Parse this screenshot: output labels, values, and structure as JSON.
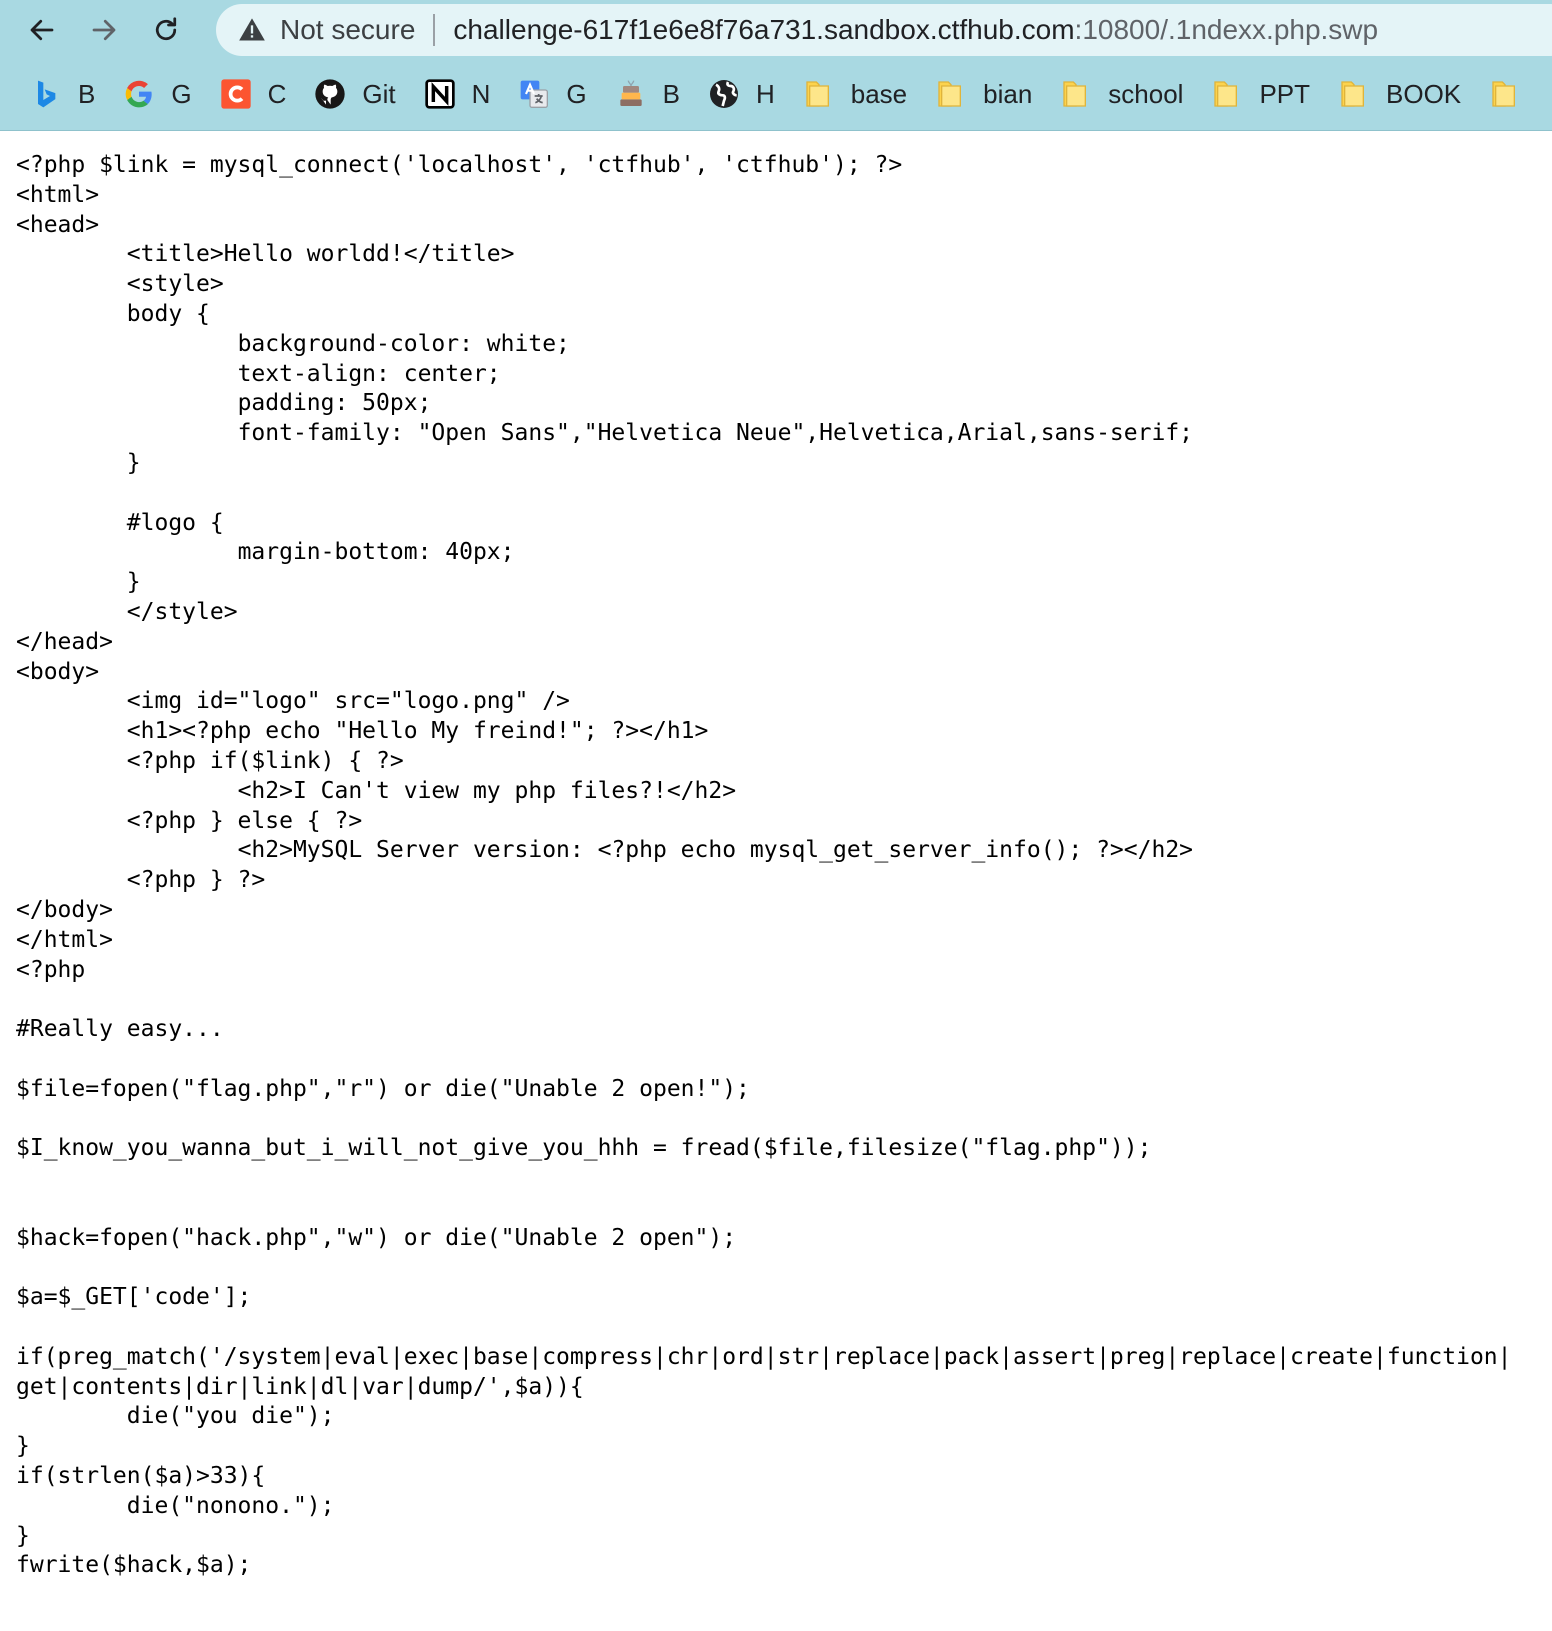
{
  "browser": {
    "security_label": "Not secure",
    "url_host": "challenge-617f1e6e8f76a731.sandbox.ctfhub.com",
    "url_path": ":10800/.1ndexx.php.swp",
    "icons": {
      "back": "back-arrow-icon",
      "forward": "forward-arrow-icon",
      "reload": "reload-icon",
      "warning": "warning-triangle-icon"
    }
  },
  "bookmarks": [
    {
      "label": "B",
      "icon": "bing-icon",
      "color": "#1d88e5"
    },
    {
      "label": "G",
      "icon": "google-icon",
      "color": "#4285f4"
    },
    {
      "label": "C",
      "icon": "csdn-icon",
      "color": "#fc5531"
    },
    {
      "label": "Git",
      "icon": "github-icon",
      "color": "#181717"
    },
    {
      "label": "N",
      "icon": "notion-icon",
      "color": "#000000"
    },
    {
      "label": "G",
      "icon": "google-translate-icon",
      "color": "#4285f4"
    },
    {
      "label": "B",
      "icon": "book-stack-icon",
      "color": "#8d6e63"
    },
    {
      "label": "H",
      "icon": "globe-icon",
      "color": "#202124"
    },
    {
      "label": "base",
      "icon": "folder-icon",
      "color": "#fcd34d"
    },
    {
      "label": "bian",
      "icon": "folder-icon",
      "color": "#fcd34d"
    },
    {
      "label": "school",
      "icon": "folder-icon",
      "color": "#fcd34d"
    },
    {
      "label": "PPT",
      "icon": "folder-icon",
      "color": "#fcd34d"
    },
    {
      "label": "BOOK",
      "icon": "folder-icon",
      "color": "#fcd34d"
    },
    {
      "label": "",
      "icon": "folder-icon",
      "color": "#fcd34d"
    }
  ],
  "source_lines": [
    "<?php $link = mysql_connect('localhost', 'ctfhub', 'ctfhub'); ?>",
    "<html>",
    "<head>",
    "\t<title>Hello worldd!</title>",
    "\t<style>",
    "\tbody {",
    "\t\tbackground-color: white;",
    "\t\ttext-align: center;",
    "\t\tpadding: 50px;",
    "\t\tfont-family: \"Open Sans\",\"Helvetica Neue\",Helvetica,Arial,sans-serif;",
    "\t}",
    "",
    "\t#logo {",
    "\t\tmargin-bottom: 40px;",
    "\t}",
    "\t</style>",
    "</head>",
    "<body>",
    "\t<img id=\"logo\" src=\"logo.png\" />",
    "\t<h1><?php echo \"Hello My freind!\"; ?></h1>",
    "\t<?php if($link) { ?>",
    "\t\t<h2>I Can't view my php files?!</h2>",
    "\t<?php } else { ?>",
    "\t\t<h2>MySQL Server version: <?php echo mysql_get_server_info(); ?></h2>",
    "\t<?php } ?>",
    "</body>",
    "</html>",
    "<?php",
    "",
    "#Really easy...",
    "",
    "$file=fopen(\"flag.php\",\"r\") or die(\"Unable 2 open!\");",
    "",
    "$I_know_you_wanna_but_i_will_not_give_you_hhh = fread($file,filesize(\"flag.php\"));",
    "",
    "",
    "$hack=fopen(\"hack.php\",\"w\") or die(\"Unable 2 open\");",
    "",
    "$a=$_GET['code'];",
    "",
    "if(preg_match('/system|eval|exec|base|compress|chr|ord|str|replace|pack|assert|preg|replace|create|function|",
    "get|contents|dir|link|dl|var|dump/',$a)){",
    "\tdie(\"you die\");",
    "}",
    "if(strlen($a)>33){",
    "\tdie(\"nonono.\");",
    "}",
    "fwrite($hack,$a);"
  ]
}
